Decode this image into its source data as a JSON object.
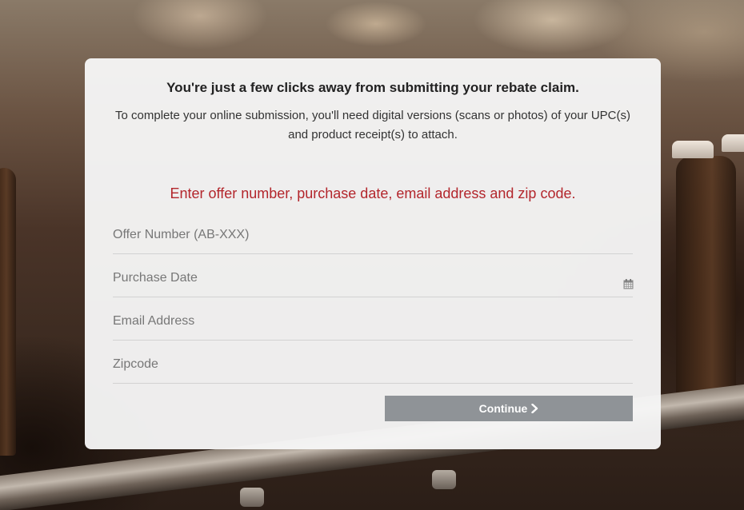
{
  "card": {
    "headline": "You're just a few clicks away from submitting your rebate claim.",
    "intro": "To complete your online submission, you'll need digital versions (scans or photos) of your UPC(s) and product receipt(s) to attach.",
    "instruction": "Enter offer number, purchase date, email address and zip code."
  },
  "form": {
    "offer_number_placeholder": "Offer Number (AB-XXX)",
    "purchase_date_placeholder": "Purchase Date",
    "email_placeholder": "Email Address",
    "zipcode_placeholder": "Zipcode",
    "continue_label": "Continue"
  },
  "icons": {
    "date_field": "calendar-icon",
    "continue_button": "chevron-right-icon"
  },
  "colors": {
    "instruction_text": "#b3262c",
    "continue_button_bg": "#8f9397",
    "card_bg": "#f6f6f6"
  }
}
